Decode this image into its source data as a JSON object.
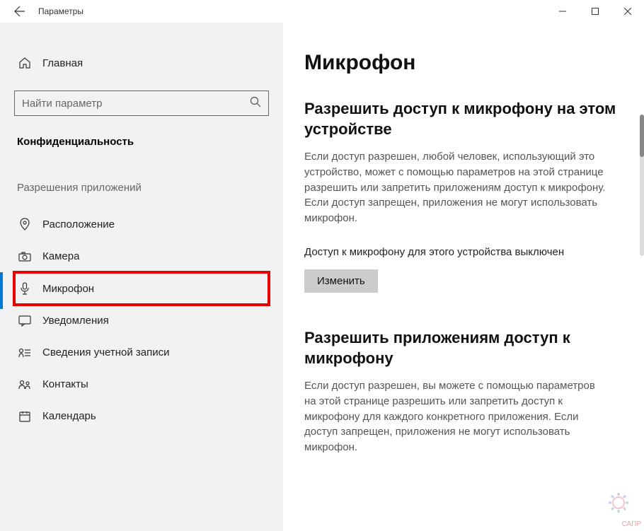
{
  "window": {
    "title": "Параметры"
  },
  "sidebar": {
    "home_label": "Главная",
    "search_placeholder": "Найти параметр",
    "category": "Конфиденциальность",
    "section_header": "Разрешения приложений",
    "items": [
      {
        "label": "Расположение"
      },
      {
        "label": "Камера"
      },
      {
        "label": "Микрофон"
      },
      {
        "label": "Уведомления"
      },
      {
        "label": "Сведения учетной записи"
      },
      {
        "label": "Контакты"
      },
      {
        "label": "Календарь"
      }
    ]
  },
  "content": {
    "page_title": "Микрофон",
    "section1_heading": "Разрешить доступ к микрофону на этом устройстве",
    "section1_text": "Если доступ разрешен, любой человек, использующий это устройство, может с помощью параметров на этой странице разрешить или запретить приложениям доступ к микрофону. Если доступ запрещен, приложения не могут использовать микрофон.",
    "status_text": "Доступ к микрофону для этого устройства выключен",
    "change_button": "Изменить",
    "section2_heading": "Разрешить приложениям доступ к микрофону",
    "section2_text": "Если доступ разрешен, вы можете с помощью параметров на этой странице разрешить или запретить доступ к микрофону для каждого конкретного приложения. Если доступ запрещен, приложения не могут использовать микрофон."
  },
  "watermark": "САПР"
}
